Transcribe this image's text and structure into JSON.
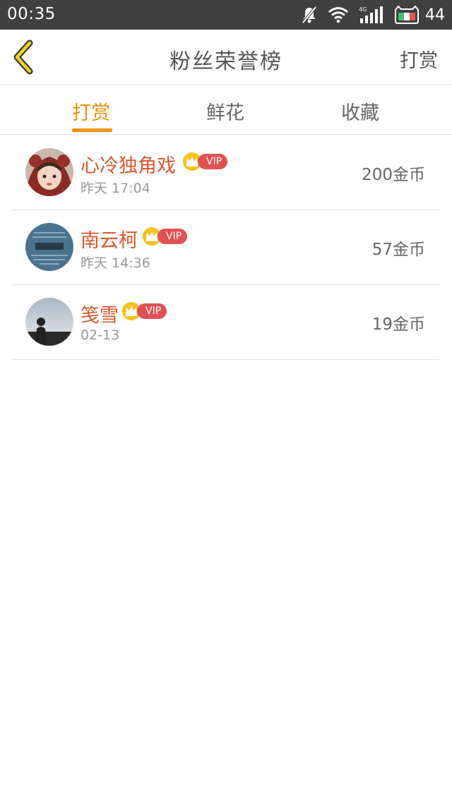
{
  "status_bar": {
    "time": "00:35",
    "network_label": "4G",
    "battery_level": "44",
    "icons": [
      "mute-icon",
      "wifi-icon",
      "cellular-signal-icon",
      "battery-cat-icon"
    ]
  },
  "header": {
    "title": "粉丝荣誉榜",
    "back_icon": "chevron-left-icon",
    "action_label": "打赏"
  },
  "tabs": [
    {
      "label": "打赏",
      "active": true
    },
    {
      "label": "鲜花",
      "active": false
    },
    {
      "label": "收藏",
      "active": false
    }
  ],
  "colors": {
    "accent": "#f0930c",
    "name": "#d9572c",
    "vip": "#e05252",
    "status_bar": "#404040"
  },
  "fans": [
    {
      "name": "心冷独角戏",
      "vip": "VIP",
      "time": "昨天  17:04",
      "amount": "200金币",
      "avatar_icon": "avatar-girl-image"
    },
    {
      "name": "南云柯",
      "vip": "VIP",
      "time": "昨天  14:36",
      "amount": "57金币",
      "avatar_icon": "avatar-calligraphy-image"
    },
    {
      "name": "笺雪",
      "vip": "VIP",
      "time": "02-13",
      "amount": "19金币",
      "avatar_icon": "avatar-silhouette-image"
    }
  ]
}
